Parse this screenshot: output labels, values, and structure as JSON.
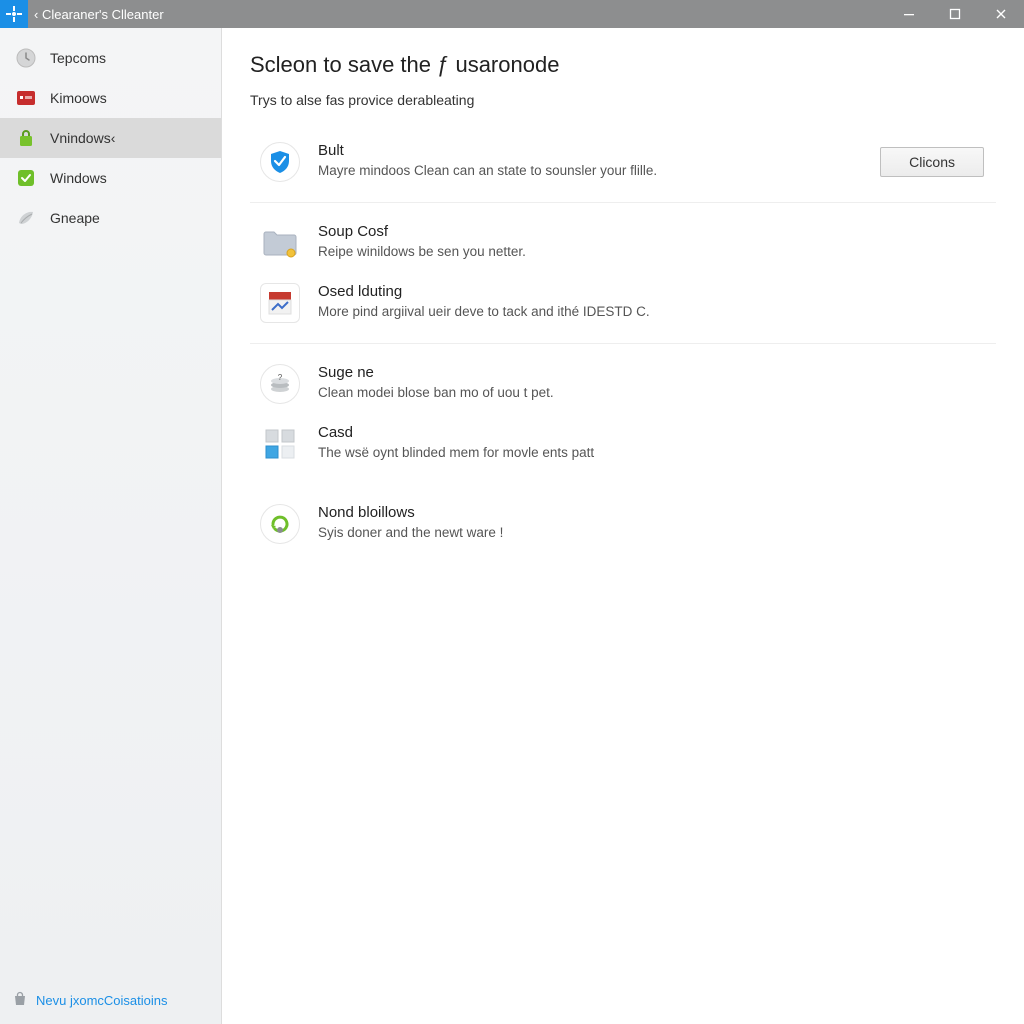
{
  "titlebar": {
    "title": "‹ Clearaner's Clleanter"
  },
  "sidebar": {
    "items": [
      {
        "label": "Tepcoms",
        "icon": "clock-icon"
      },
      {
        "label": "Kimoows",
        "icon": "tile-red-icon"
      },
      {
        "label": "Vnindows‹",
        "icon": "lock-green-icon",
        "selected": true
      },
      {
        "label": "Windows",
        "icon": "tool-green-icon"
      },
      {
        "label": "Gneape",
        "icon": "leaf-icon"
      }
    ],
    "promo": {
      "label": "Nevu jxomcCoisatioins"
    }
  },
  "main": {
    "title": "Scleon to save the ƒ usaronode",
    "subtitle": "Trys to alse fas provice derableating",
    "action_button": "Clicons",
    "items": [
      {
        "icon": "shield-blue-icon",
        "title": "Bult",
        "desc": "Mayre mindoos Clean can an state to sounsler your flille."
      },
      {
        "icon": "folder-icon",
        "title": "Soup Cosf",
        "desc": "Reipe winildows be sen you netter."
      },
      {
        "icon": "app-red-icon",
        "title": "Osed lduting",
        "desc": "More pind argiival ueir deve to tack and ithé IDESTD C."
      },
      {
        "icon": "stack-icon",
        "title": "Suge ne",
        "desc": "Clean modei blose ban mo of uou t pet."
      },
      {
        "icon": "grid-icon",
        "title": "Casd",
        "desc": "The wsë oynt blinded mem for movle ents patt"
      },
      {
        "icon": "refresh-green-icon",
        "title": "Nond bloillows",
        "desc": "Syis doner and the newt ware !"
      }
    ]
  }
}
